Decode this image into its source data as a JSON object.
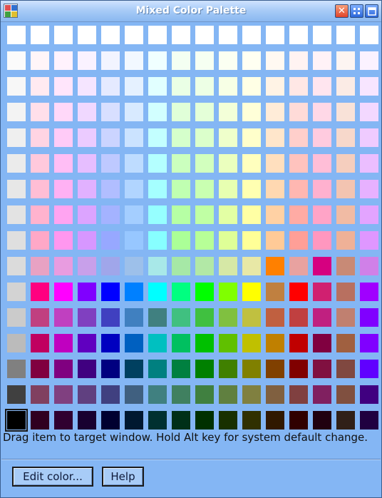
{
  "window": {
    "title": "Mixed Color Palette"
  },
  "titlebar_buttons": {
    "close": "✕"
  },
  "palette": {
    "selected_row": 15,
    "selected_col": 0,
    "rows": [
      [
        "#ffffff",
        "#ffffff",
        "#ffffff",
        "#ffffff",
        "#ffffff",
        "#ffffff",
        "#ffffff",
        "#ffffff",
        "#ffffff",
        "#ffffff",
        "#ffffff",
        "#ffffff",
        "#ffffff",
        "#ffffff",
        "#ffffff",
        "#ffffff"
      ],
      [
        "#fbfbfb",
        "#fff5f8",
        "#fff2fd",
        "#faf2ff",
        "#f2f4ff",
        "#f2f8ff",
        "#f0ffff",
        "#f4fff2",
        "#f6fff2",
        "#fbfff2",
        "#fffff2",
        "#fff9f2",
        "#fff3f2",
        "#fff2f7",
        "#fdf5f2",
        "#fbf2ff"
      ],
      [
        "#f7f7f7",
        "#ffeaf1",
        "#ffe5fb",
        "#f5e5ff",
        "#e5eaff",
        "#e5f1ff",
        "#e1ffff",
        "#eaffe5",
        "#edffe5",
        "#f7ffe5",
        "#ffffe5",
        "#fff3e5",
        "#ffe7e5",
        "#ffe5ef",
        "#fbebe5",
        "#f7e5ff"
      ],
      [
        "#f3f3f3",
        "#ffdfea",
        "#ffd8f9",
        "#f0d8ff",
        "#d8dfff",
        "#d8eaff",
        "#d2ffff",
        "#e0ffd8",
        "#e4ffd8",
        "#f3ffd8",
        "#ffffd8",
        "#ffecd8",
        "#ffdbd8",
        "#ffd8e7",
        "#f9e2d8",
        "#f3d8ff"
      ],
      [
        "#efefef",
        "#ffd4e3",
        "#ffcbf7",
        "#ebcbff",
        "#cbd4ff",
        "#cbe3ff",
        "#c3ffff",
        "#d5ffcb",
        "#dbffcb",
        "#efffcb",
        "#ffffcb",
        "#ffe6cb",
        "#ffcfcb",
        "#ffcbdf",
        "#f7d8cb",
        "#efcbff"
      ],
      [
        "#ebebeb",
        "#ffc9dc",
        "#ffbef5",
        "#e6beff",
        "#bec9ff",
        "#bedcff",
        "#b4ffff",
        "#cbffbe",
        "#d2ffbe",
        "#ebffbe",
        "#ffffbe",
        "#ffdfbe",
        "#ffc3be",
        "#ffbed7",
        "#f5cebe",
        "#ebbeff"
      ],
      [
        "#e7e7e7",
        "#ffbed5",
        "#ffb1f3",
        "#e1b1ff",
        "#b1beff",
        "#b1d5ff",
        "#a5ffff",
        "#c0ffb1",
        "#c9ffb1",
        "#e7ffb1",
        "#ffffb1",
        "#ffd8b1",
        "#ffb7b1",
        "#ffb1cf",
        "#f3c4b1",
        "#e7b1ff"
      ],
      [
        "#e3e3e3",
        "#ffb3ce",
        "#ffa4f1",
        "#dca4ff",
        "#a4b3ff",
        "#a4ceff",
        "#96ffff",
        "#b6ffa4",
        "#c0ffa4",
        "#e3ffa4",
        "#ffffa4",
        "#ffd1a4",
        "#ffaba4",
        "#ffa4c7",
        "#f1bba4",
        "#e3a4ff"
      ],
      [
        "#dfdfdf",
        "#ffa8c7",
        "#ff97ef",
        "#d797ff",
        "#97a8ff",
        "#97c7ff",
        "#87ffff",
        "#abff97",
        "#b7ff97",
        "#dfff97",
        "#ffff97",
        "#ffca97",
        "#ff9f97",
        "#ff97bf",
        "#efb197",
        "#df97ff"
      ],
      [
        "#dbdbdb",
        "#e8a2c3",
        "#e89ce0",
        "#c8a0ea",
        "#a0a6ea",
        "#9dc0ea",
        "#a8e8e8",
        "#a6e8a6",
        "#b2e8a6",
        "#d6e8a6",
        "#e8e8a6",
        "#ff8000",
        "#e8a2a0",
        "#d60080",
        "#c88a76",
        "#d080e8"
      ],
      [
        "#d3d3d3",
        "#ff0080",
        "#ff00ff",
        "#8000ff",
        "#0000ff",
        "#0080ff",
        "#00ffff",
        "#00ff80",
        "#00ff00",
        "#80ff00",
        "#ffff00",
        "#c08040",
        "#ff0000",
        "#d02070",
        "#b87060",
        "#a000ff"
      ],
      [
        "#cbcbcb",
        "#c04080",
        "#c040c0",
        "#8040c0",
        "#4040c0",
        "#4080c0",
        "#408080",
        "#40c080",
        "#40c040",
        "#80c040",
        "#c0c040",
        "#c06040",
        "#c04040",
        "#c02080",
        "#c08070",
        "#8000ff"
      ],
      [
        "#bbbbbb",
        "#c00060",
        "#c000c0",
        "#6000c0",
        "#0000c0",
        "#0060c0",
        "#00c0c0",
        "#00c060",
        "#00c000",
        "#60c000",
        "#c0c000",
        "#c08000",
        "#c00000",
        "#800040",
        "#a06040",
        "#8000ff"
      ],
      [
        "#808080",
        "#800040",
        "#800080",
        "#400080",
        "#000080",
        "#004060",
        "#008080",
        "#008040",
        "#008000",
        "#408000",
        "#808000",
        "#804000",
        "#800000",
        "#801040",
        "#804840",
        "#6000ff"
      ],
      [
        "#404040",
        "#804060",
        "#804080",
        "#604080",
        "#404080",
        "#406080",
        "#408080",
        "#408060",
        "#408040",
        "#608040",
        "#808040",
        "#806040",
        "#804040",
        "#802060",
        "#805040",
        "#400080"
      ],
      [
        "#000000",
        "#300020",
        "#300030",
        "#180030",
        "#000030",
        "#001830",
        "#003030",
        "#003018",
        "#003000",
        "#183000",
        "#303000",
        "#301800",
        "#300000",
        "#200010",
        "#302018",
        "#200040"
      ]
    ]
  },
  "status": {
    "text": "Drag item to target window.  Hold Alt key for system default change."
  },
  "buttons": {
    "edit_color": "Edit color...",
    "help": "Help"
  }
}
